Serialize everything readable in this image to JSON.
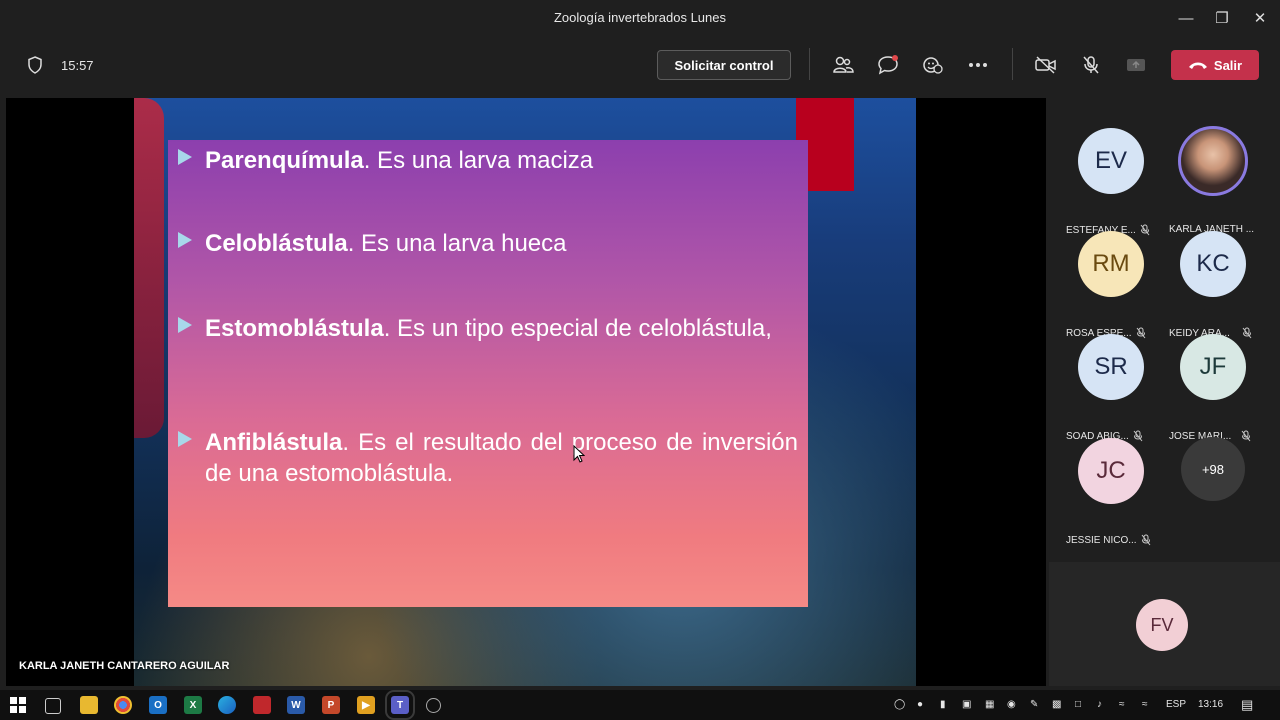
{
  "window": {
    "title": "Zoología invertebrados Lunes"
  },
  "toolbar": {
    "time": "15:57",
    "request_control": "Solicitar control",
    "leave": "Salir"
  },
  "slide": {
    "bullets": [
      {
        "term": "Parenquímula",
        "text": ". Es una larva maciza"
      },
      {
        "term": "Celoblástula",
        "text": ". Es una larva hueca"
      },
      {
        "term": "Estomoblástula",
        "text": ". Es un tipo especial de celoblástula,"
      },
      {
        "term": "Anfiblástula",
        "text": ". Es el resultado del proceso de inversión de una estomoblástula."
      }
    ]
  },
  "presenter": "KARLA JANETH CANTARERO AGUILAR",
  "participants": [
    {
      "initials": "EV",
      "name": "ESTEFANY E...",
      "color": "#d6e4f5"
    },
    {
      "initials": "",
      "name": "KARLA JANETH ...",
      "color": "#b59a8a"
    },
    {
      "initials": "RM",
      "name": "ROSA ESPE...",
      "color": "#f7e6b8"
    },
    {
      "initials": "KC",
      "name": "KEIDY ARA...",
      "color": "#d6e4f5"
    },
    {
      "initials": "SR",
      "name": "SOAD ABIG...",
      "color": "#d6e4f5"
    },
    {
      "initials": "JF",
      "name": "JOSE MARI...",
      "color": "#d8e8e4"
    },
    {
      "initials": "JC",
      "name": "JESSIE NICO...",
      "color": "#f2d4e0"
    }
  ],
  "more_count": "+98",
  "self_tile": {
    "initials": "FV"
  },
  "taskbar": {
    "lang": "ESP",
    "clock": "13:16"
  }
}
